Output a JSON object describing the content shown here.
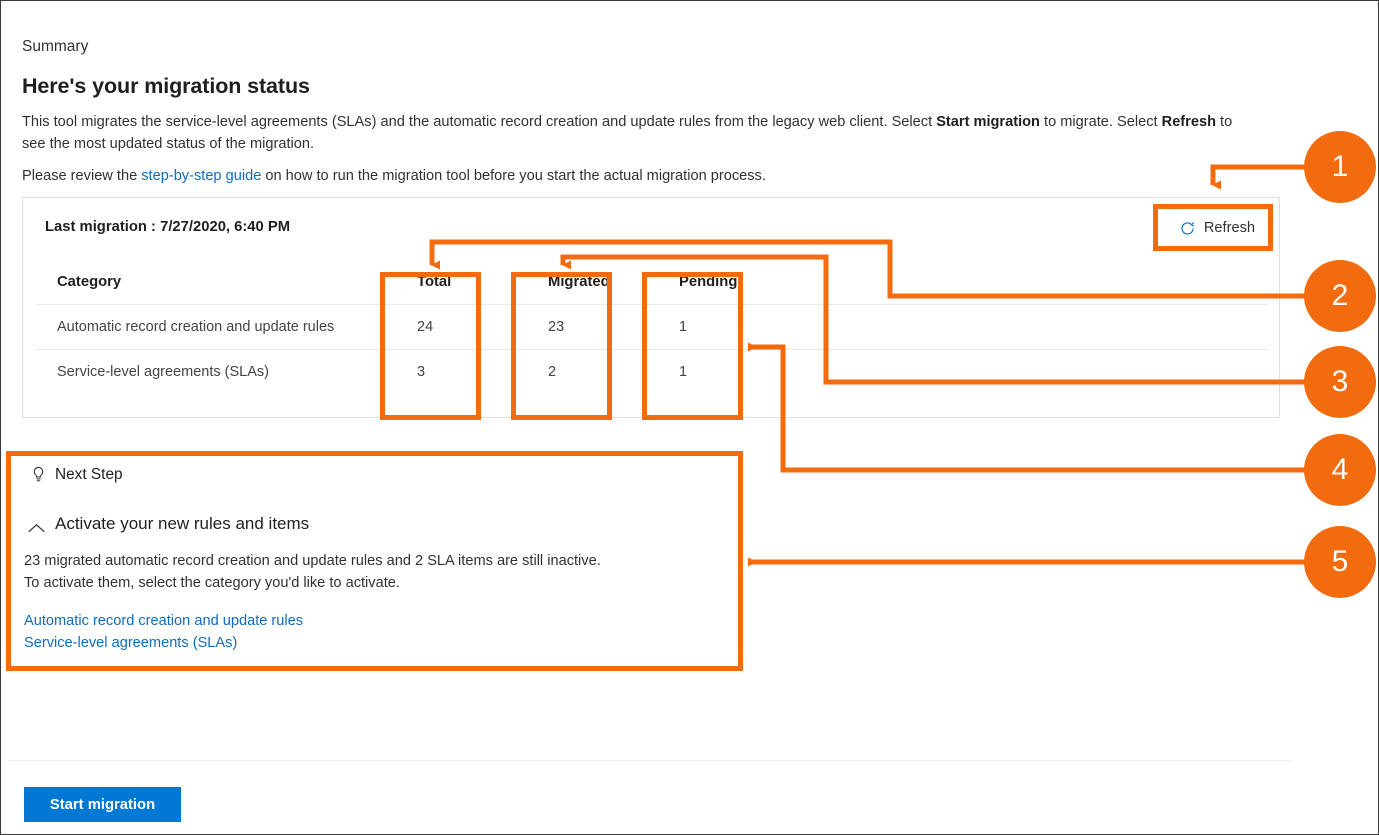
{
  "page": {
    "eyebrow": "Summary",
    "title": "Here's your migration status",
    "intro_part1": "This tool migrates the service-level agreements (SLAs) and the automatic record creation and update rules from the legacy web client. Select ",
    "intro_bold1": "Start migration",
    "intro_part2": " to migrate. Select ",
    "intro_bold2": "Refresh",
    "intro_part3": " to see the most updated status of the migration.",
    "guide_prefix": "Please review the ",
    "guide_link": "step-by-step guide",
    "guide_suffix": " on how to run the migration tool before you start the actual migration process."
  },
  "card": {
    "last_migration_label": "Last migration : 7/27/2020, 6:40 PM",
    "refresh_label": "Refresh",
    "refresh_icon": "refresh-circular-arrow-icon"
  },
  "table": {
    "columns": [
      "Category",
      "Total",
      "Migrated",
      "Pending"
    ],
    "rows": [
      {
        "category": "Automatic record creation and update rules",
        "total": "24",
        "migrated": "23",
        "pending": "1"
      },
      {
        "category": "Service-level agreements (SLAs)",
        "total": "3",
        "migrated": "2",
        "pending": "1"
      }
    ]
  },
  "next_step": {
    "title": "Next Step",
    "title_icon": "lightbulb-icon",
    "section_heading": "Activate your new rules and items",
    "section_icon": "chevron-up-icon",
    "body_line1": "23 migrated automatic record creation and update rules and 2 SLA items are still inactive.",
    "body_line2": "To activate them, select the category you'd like to activate.",
    "links": [
      "Automatic record creation and update rules",
      "Service-level agreements (SLAs)"
    ]
  },
  "footer": {
    "start_migration_label": "Start migration"
  },
  "annotations": {
    "accent_color": "#f26b0f",
    "callouts": [
      {
        "number": "1",
        "target": "refresh-button"
      },
      {
        "number": "2",
        "target": "total-column"
      },
      {
        "number": "3",
        "target": "migrated-column"
      },
      {
        "number": "4",
        "target": "pending-column"
      },
      {
        "number": "5",
        "target": "next-step-panel"
      }
    ]
  },
  "colors": {
    "link": "#0f6cbd",
    "primary_button": "#0078d4",
    "accent": "#f26b0f"
  }
}
